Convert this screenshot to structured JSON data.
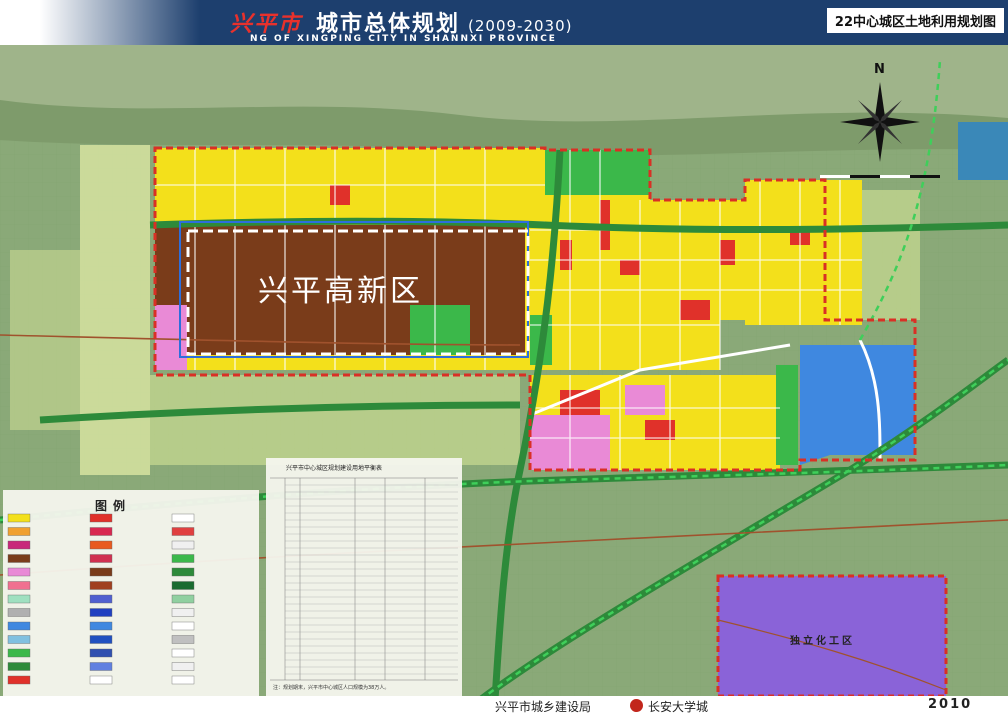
{
  "header": {
    "city_name": "兴平市",
    "title": "城市总体规划",
    "years": "(2009-2030)",
    "subtitle": "NG OF XINGPING CITY IN SHANNXI PROVINCE",
    "sheet_label": "22中心城区土地利用规划图"
  },
  "map": {
    "north_label": "N",
    "zone_label": "兴平高新区",
    "industrial_zone_label": "独立化工区"
  },
  "legend": {
    "title": "图例"
  },
  "table": {
    "title": "兴平市中心城区规划建设用地平衡表",
    "note": "注：规划期末，兴平市中心城区人口规模为38万人。"
  },
  "footer": {
    "planner": "兴平市城乡建设局",
    "institute": "长安大学城",
    "year": "2010"
  },
  "colors": {
    "header_bg": "#1d3f6e",
    "city_name": "#e8312c",
    "residential": "#f3e01b",
    "industrial": "#7a3c1a",
    "commercial": "#e0312a",
    "green_space": "#3bb84a",
    "education": "#e98ad6",
    "logistics": "#3f88e0",
    "chemical_zone": "#8a63d8",
    "boundary": "#d93025"
  }
}
